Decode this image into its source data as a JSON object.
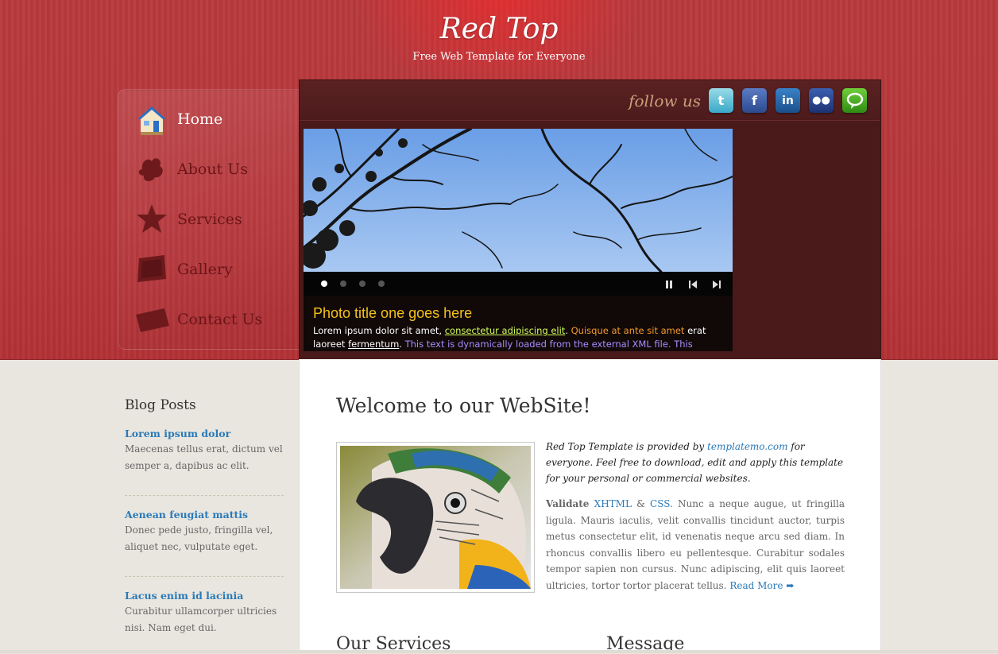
{
  "header": {
    "title": "Red Top",
    "subtitle": "Free Web Template for Everyone"
  },
  "menu": {
    "items": [
      {
        "label": "Home",
        "icon": "house-icon"
      },
      {
        "label": "About Us",
        "icon": "people-icon"
      },
      {
        "label": "Services",
        "icon": "star-icon"
      },
      {
        "label": "Gallery",
        "icon": "photos-icon"
      },
      {
        "label": "Contact Us",
        "icon": "envelope-icon"
      }
    ]
  },
  "follow": {
    "text": "follow us",
    "icons": [
      "twitter-icon",
      "facebook-icon",
      "linkedin-icon",
      "myspace-icon",
      "chat-icon"
    ]
  },
  "slider": {
    "caption_title": "Photo title one goes here",
    "text_1": "Lorem ipsum dolor sit amet, ",
    "link_1": "consectetur adipiscing elit",
    "text_2": ". ",
    "orange_text": "Quisque at ante sit amet",
    "text_3": " erat laoreet ",
    "link_2": "fermentum",
    "text_4": ". ",
    "purple_text": "This text is dynamically loaded from the external XML file. This"
  },
  "content": {
    "heading": "Welcome to our WebSite!",
    "intro_1": "Red Top Template is provided by ",
    "intro_link": "templatemo.com",
    "intro_2": " for everyone. Feel free to download, edit and apply this template for your personal or commercial websites.",
    "validate_label": "Validate",
    "xhtml": "XHTML",
    "amp": " & ",
    "css": "CSS",
    "body": ". Nunc a neque augue, ut fringilla ligula. Mauris iaculis, velit convallis tincidunt auctor, turpis metus consectetur elit, id venenatis neque arcu sed diam. In rhoncus convallis libero eu pellentesque. Curabitur sodales tempor sapien non cursus. Nunc adipiscing, elit quis laoreet ultricies, tortor tortor placerat tellus. ",
    "read_more": "Read More ➡",
    "services_heading": "Our Services",
    "message_heading": "Message"
  },
  "blog": {
    "title": "Blog Posts",
    "posts": [
      {
        "title": "Lorem ipsum dolor",
        "body": "Maecenas tellus erat, dictum vel semper a, dapibus ac elit."
      },
      {
        "title": "Aenean feugiat mattis",
        "body": "Donec pede justo, fringilla vel, aliquet nec, vulputate eget."
      },
      {
        "title": "Lacus enim id lacinia",
        "body": "Curabitur ullamcorper ultricies nisi. Nam eget dui."
      }
    ]
  },
  "colors": {
    "header_red": "#b8383c",
    "dark_panel": "#4a1a1b",
    "link_blue": "#2a7ab8",
    "caption_yellow": "#f5c21b"
  }
}
